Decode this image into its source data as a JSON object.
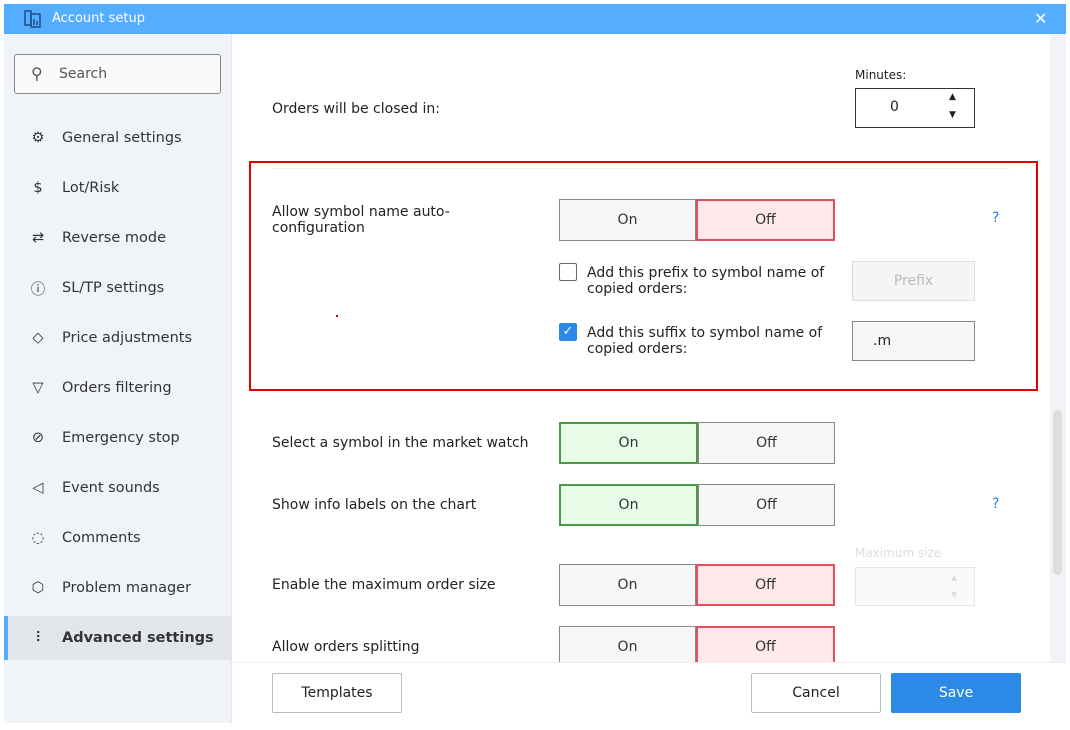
{
  "window": {
    "title": "Account setup"
  },
  "sidebar": {
    "search_placeholder": "Search",
    "items": [
      {
        "label": "General settings",
        "icon": "gear-icon"
      },
      {
        "label": "Lot/Risk",
        "icon": "dollar-icon"
      },
      {
        "label": "Reverse mode",
        "icon": "reverse-icon"
      },
      {
        "label": "SL/TP settings",
        "icon": "alert-icon"
      },
      {
        "label": "Price adjustments",
        "icon": "tag-icon"
      },
      {
        "label": "Orders filtering",
        "icon": "filter-icon"
      },
      {
        "label": "Emergency stop",
        "icon": "stop-icon"
      },
      {
        "label": "Event sounds",
        "icon": "speaker-icon"
      },
      {
        "label": "Comments",
        "icon": "comment-icon"
      },
      {
        "label": "Problem manager",
        "icon": "shield-icon"
      },
      {
        "label": "Advanced settings",
        "icon": "sliders-icon",
        "active": true
      }
    ]
  },
  "main": {
    "orders_closed": {
      "label": "Orders will be closed in:",
      "unit_label": "Minutes:",
      "value": "0"
    },
    "symbol_autoconf": {
      "label": "Allow symbol name auto-configuration",
      "on": "On",
      "off": "Off",
      "selected": "Off",
      "help": "?",
      "prefix": {
        "label": "Add this prefix to symbol name of copied orders:",
        "checked": false,
        "placeholder": "Prefix",
        "value": ""
      },
      "suffix": {
        "label": "Add this suffix to symbol name of copied orders:",
        "checked": true,
        "value": ".m"
      }
    },
    "market_watch": {
      "label": "Select a symbol in the market watch",
      "on": "On",
      "off": "Off",
      "selected": "On"
    },
    "info_labels": {
      "label": "Show info labels on the chart",
      "on": "On",
      "off": "Off",
      "selected": "On",
      "help": "?"
    },
    "max_order": {
      "label": "Enable the maximum order size",
      "on": "On",
      "off": "Off",
      "selected": "Off",
      "field_label": "Maximum size",
      "value": ""
    },
    "splitting": {
      "label": "Allow orders splitting",
      "on": "On",
      "off": "Off",
      "selected": "Off"
    }
  },
  "footer": {
    "templates": "Templates",
    "cancel": "Cancel",
    "save": "Save"
  },
  "colors": {
    "accent": "#55adff",
    "save": "#2a8ae6",
    "highlight": "#e00000"
  }
}
